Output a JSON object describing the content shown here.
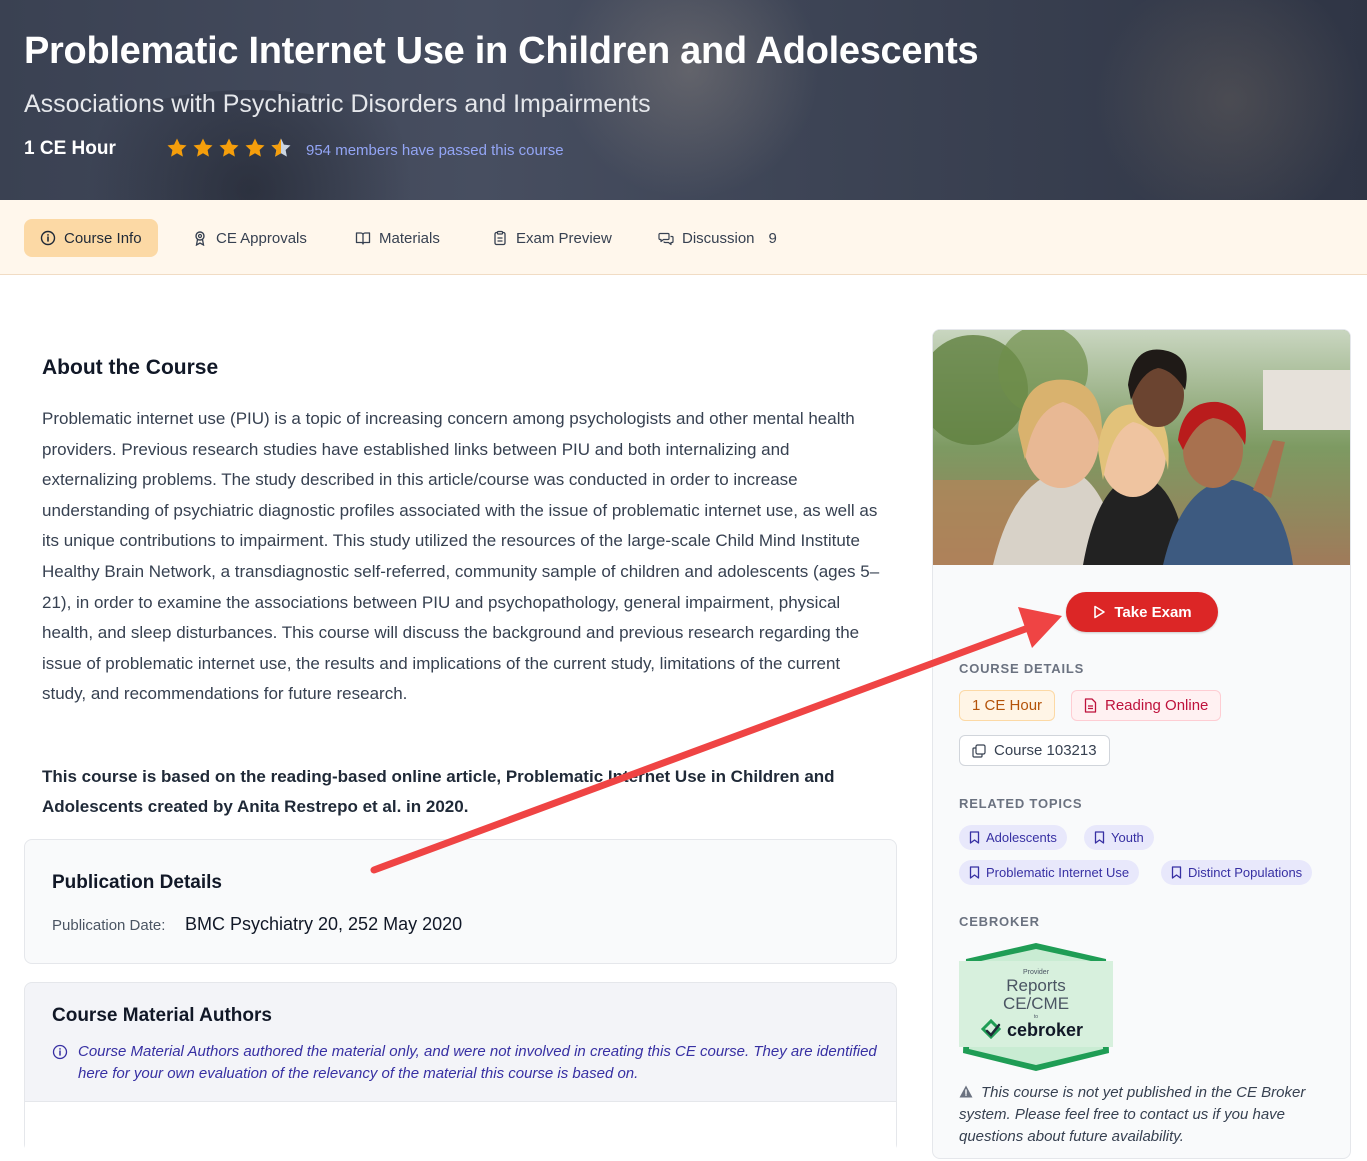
{
  "hero": {
    "title": "Problematic Internet Use in Children and Adolescents",
    "subtitle": "Associations with Psychiatric Disorders and Impairments",
    "ce_hours": "1 CE Hour",
    "rating": 4.5,
    "passed_text": "954 members have passed this course"
  },
  "tabs": [
    {
      "label": "Course Info",
      "icon": "info-circle-icon",
      "active": true
    },
    {
      "label": "CE Approvals",
      "icon": "award-icon"
    },
    {
      "label": "Materials",
      "icon": "book-open-icon"
    },
    {
      "label": "Exam Preview",
      "icon": "clipboard-icon"
    },
    {
      "label": "Discussion",
      "icon": "chat-icon",
      "count": "9"
    }
  ],
  "about": {
    "title": "About the Course",
    "text": "Problematic internet use (PIU) is a topic of increasing concern among psychologists and other mental health providers. Previous research studies have established links between PIU and both internalizing and externalizing problems. The study described in this article/course was conducted in order to increase understanding of psychiatric diagnostic profiles associated with the issue of problematic internet use, as well as its unique contributions to impairment. This study utilized the resources of the large-scale Child Mind Institute Healthy Brain Network, a transdiagnostic self-referred, community sample of children and adolescents (ages 5–21), in order to examine the associations between PIU and psychopathology, general impairment, physical health, and sleep disturbances. This course will discuss the background and previous research regarding the issue of problematic internet use, the results and implications of the current study, limitations of the current study, and recommendations for future research.",
    "based_on": "This course is based on the reading-based online article, Problematic Internet Use in Children and Adolescents created by Anita Restrepo et al. in 2020."
  },
  "publication": {
    "title": "Publication Details",
    "date_label": "Publication Date:",
    "date_value": "BMC Psychiatry 20, 252 May 2020"
  },
  "authors": {
    "title": "Course Material Authors",
    "note": "Course Material Authors authored the material only, and were not involved in creating this CE course. They are identified here for your own evaluation of the relevancy of the material this course is based on."
  },
  "sidebar": {
    "take_exam": "Take Exam",
    "course_details_heading": "COURSE DETAILS",
    "ce_chip": "1 CE Hour",
    "format_chip": "Reading Online",
    "course_chip": "Course 103213",
    "related_heading": "RELATED TOPICS",
    "topics": [
      "Adolescents",
      "Youth",
      "Problematic Internet Use",
      "Distinct Populations"
    ],
    "cebroker_heading": "CEBROKER",
    "badge": {
      "line1": "Provider",
      "line2": "Reports",
      "line3": "CE/CME",
      "line4": "to",
      "brand": "cebroker"
    },
    "warning": "This course is not yet published in the CE Broker system. Please feel free to contact us if you have questions about future availability."
  },
  "colors": {
    "accent": "#dc2626",
    "tab_active": "#fcd9a5",
    "link": "#93a5f5",
    "tag_bg": "#e8e8fb",
    "star": "#f59e0b"
  }
}
